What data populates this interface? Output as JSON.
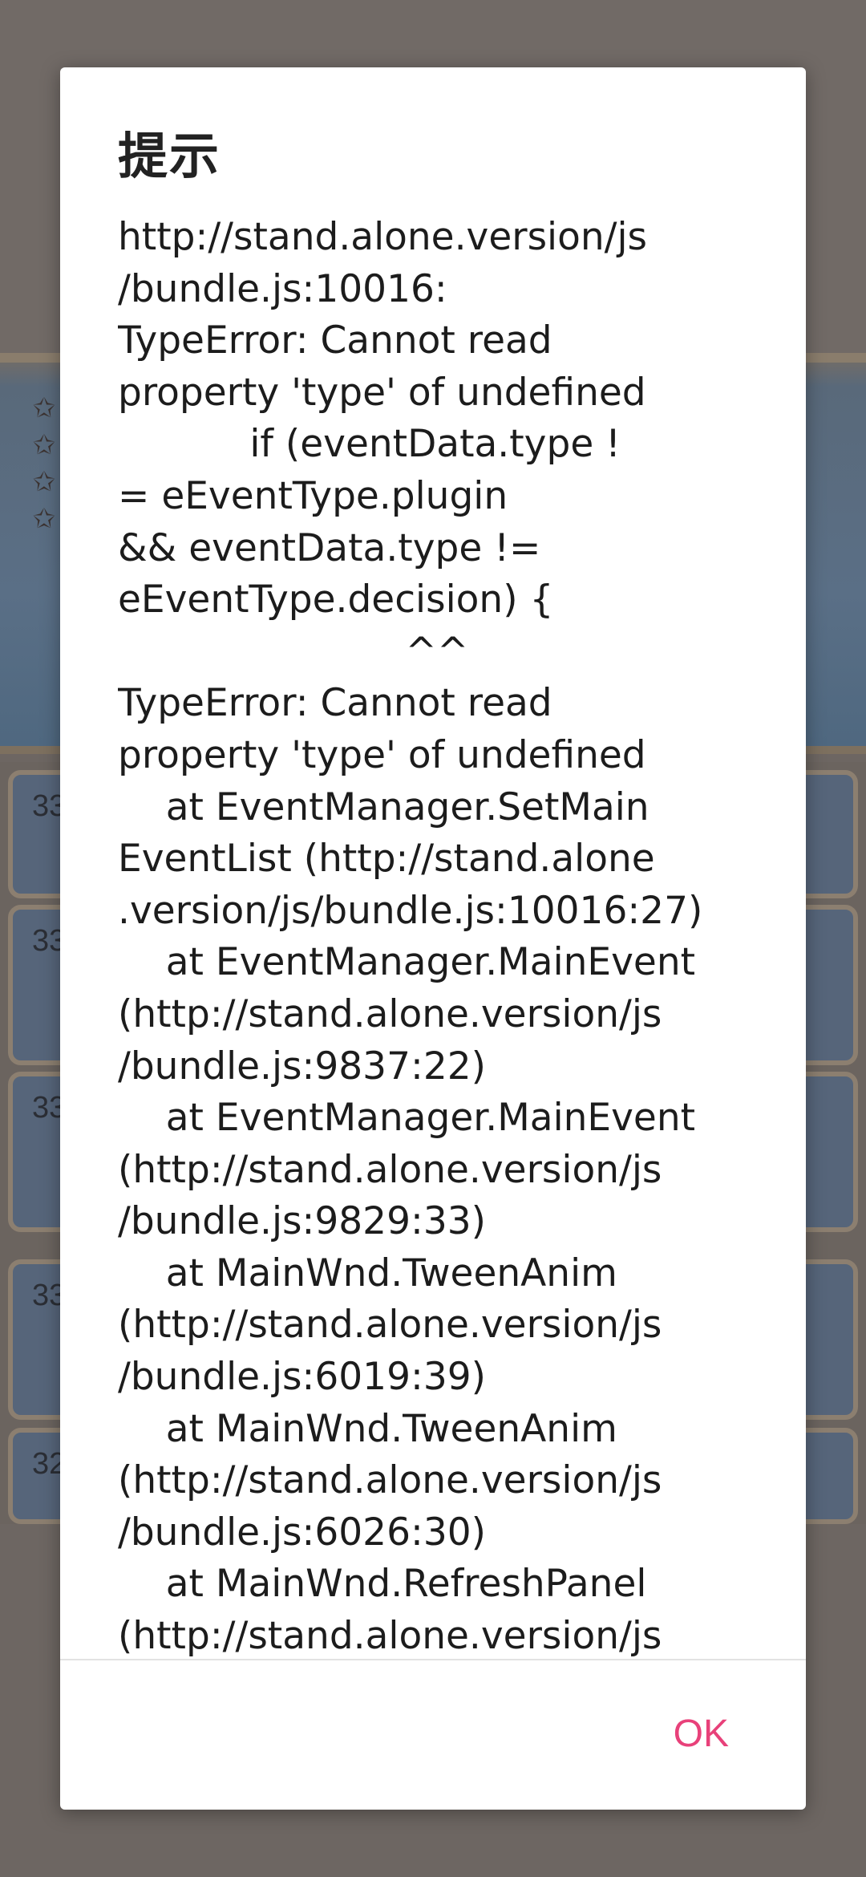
{
  "background": {
    "list_items": [
      "33",
      "33",
      "33",
      "33",
      "32"
    ]
  },
  "dialog": {
    "title": "提示",
    "message_lines": [
      "http://stand.alone.version/js",
      "/bundle.js:10016:",
      "TypeError: Cannot read",
      "property 'type' of undefined",
      "           if (eventData.type !",
      "= eEventType.plugin",
      "&& eventData.type !=",
      "eEventType.decision) {",
      "                        ^^",
      "TypeError: Cannot read",
      "property 'type' of undefined",
      "    at EventManager.SetMain",
      "EventList (http://stand.alone",
      ".version/js/bundle.js:10016:27)",
      "    at EventManager.MainEvent",
      "(http://stand.alone.version/js",
      "/bundle.js:9837:22)",
      "    at EventManager.MainEvent",
      "(http://stand.alone.version/js",
      "/bundle.js:9829:33)",
      "    at MainWnd.TweenAnim",
      "(http://stand.alone.version/js",
      "/bundle.js:6019:39)",
      "    at MainWnd.TweenAnim",
      "(http://stand.alone.version/js",
      "/bundle.js:6026:30)",
      "    at MainWnd.RefreshPanel",
      "(http://stand.alone.version/js"
    ],
    "ok_label": "OK"
  }
}
